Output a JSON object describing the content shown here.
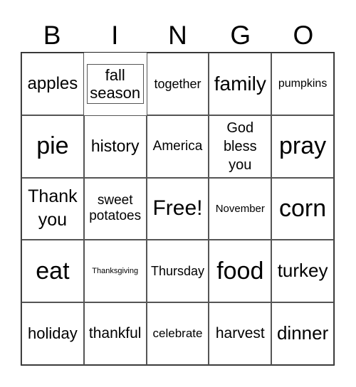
{
  "header": [
    "B",
    "I",
    "N",
    "G",
    "O"
  ],
  "cells": [
    "apples",
    "fall season",
    "together",
    "family",
    "pumpkins",
    "pie",
    "history",
    "America",
    "God bless you",
    "pray",
    "Thank you",
    "sweet potatoes",
    "Free!",
    "November",
    "corn",
    "eat",
    "Thanksgiving",
    "Thursday",
    "food",
    "turkey",
    "holiday",
    "thankful",
    "celebrate",
    "harvest",
    "dinner"
  ]
}
